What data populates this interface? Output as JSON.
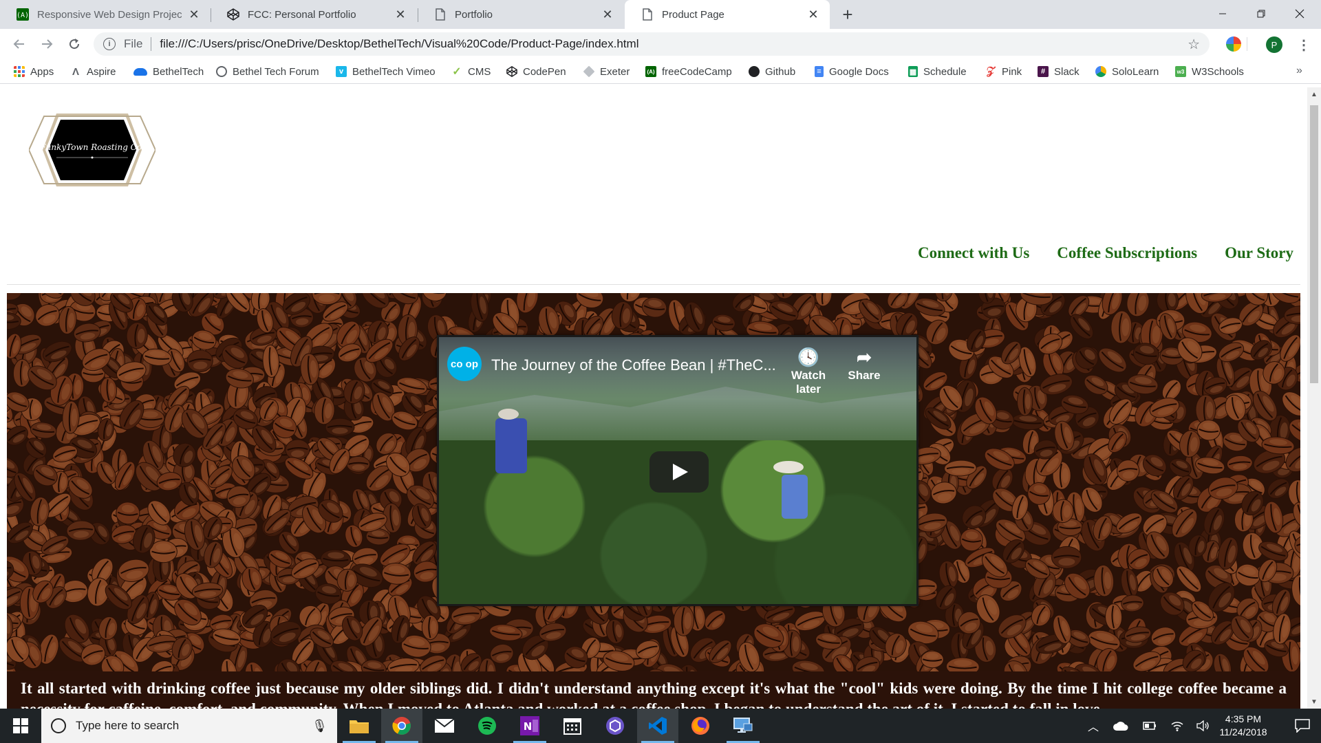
{
  "tabs": [
    {
      "title": "Responsive Web Design Projects",
      "active": false
    },
    {
      "title": "FCC: Personal Portfolio",
      "active": false
    },
    {
      "title": "Portfolio",
      "active": false
    },
    {
      "title": "Product Page",
      "active": true
    }
  ],
  "toolbar": {
    "scheme_label": "File",
    "url": "file:///C:/Users/prisc/OneDrive/Desktop/BethelTech/Visual%20Code/Product-Page/index.html",
    "profile_initial": "P"
  },
  "bookmarks": [
    {
      "label": "Apps",
      "icon": "apps-grid-icon",
      "color": "#4285f4"
    },
    {
      "label": "Aspire",
      "icon": "aspire-icon",
      "color": "#5f6368"
    },
    {
      "label": "BethelTech",
      "icon": "cloud-icon",
      "color": "#1a73e8"
    },
    {
      "label": "Bethel Tech Forum",
      "icon": "forum-icon",
      "color": "#5f6368"
    },
    {
      "label": "BethelTech Vimeo",
      "icon": "vimeo-icon",
      "color": "#1ab7ea"
    },
    {
      "label": "CMS",
      "icon": "cms-icon",
      "color": "#8bc34a"
    },
    {
      "label": "CodePen",
      "icon": "codepen-icon",
      "color": "#202124"
    },
    {
      "label": "Exeter",
      "icon": "exeter-icon",
      "color": "#9aa0a6"
    },
    {
      "label": "freeCodeCamp",
      "icon": "freecodecamp-icon",
      "color": "#006400"
    },
    {
      "label": "Github",
      "icon": "github-icon",
      "color": "#202124"
    },
    {
      "label": "Google Docs",
      "icon": "google-docs-icon",
      "color": "#4285f4"
    },
    {
      "label": "Schedule",
      "icon": "sheets-icon",
      "color": "#0f9d58"
    },
    {
      "label": "Pink",
      "icon": "pink-icon",
      "color": "#e53935"
    },
    {
      "label": "Slack",
      "icon": "slack-icon",
      "color": "#4a154b"
    },
    {
      "label": "SoloLearn",
      "icon": "sololearn-icon",
      "color": "#f4b400"
    },
    {
      "label": "W3Schools",
      "icon": "w3schools-icon",
      "color": "#4caf50"
    }
  ],
  "page": {
    "logo_text": "FunkyTown Roasting Co.",
    "nav": [
      "Connect with Us",
      "Coffee Subscriptions",
      "Our Story"
    ],
    "video": {
      "channel_label": "co op",
      "title": "The Journey of the Coffee Bean | #TheC...",
      "watch_later": "Watch later",
      "share": "Share"
    },
    "story_text": "It all started with drinking coffee just because my older siblings did. I didn't understand anything except it's what the \"cool\" kids were doing. By the time I hit college coffee became a necessity for caffeine, comfort, and community. When I moved to Atlanta and worked at a coffee shop, I began to understand the art of it. I started to fall in love"
  },
  "taskbar": {
    "search_placeholder": "Type here to search",
    "time": "4:35 PM",
    "date": "11/24/2018"
  },
  "colors": {
    "nav_green": "#1e6b16",
    "story_bg": "#2b1209",
    "taskbar": "#1f2427"
  }
}
